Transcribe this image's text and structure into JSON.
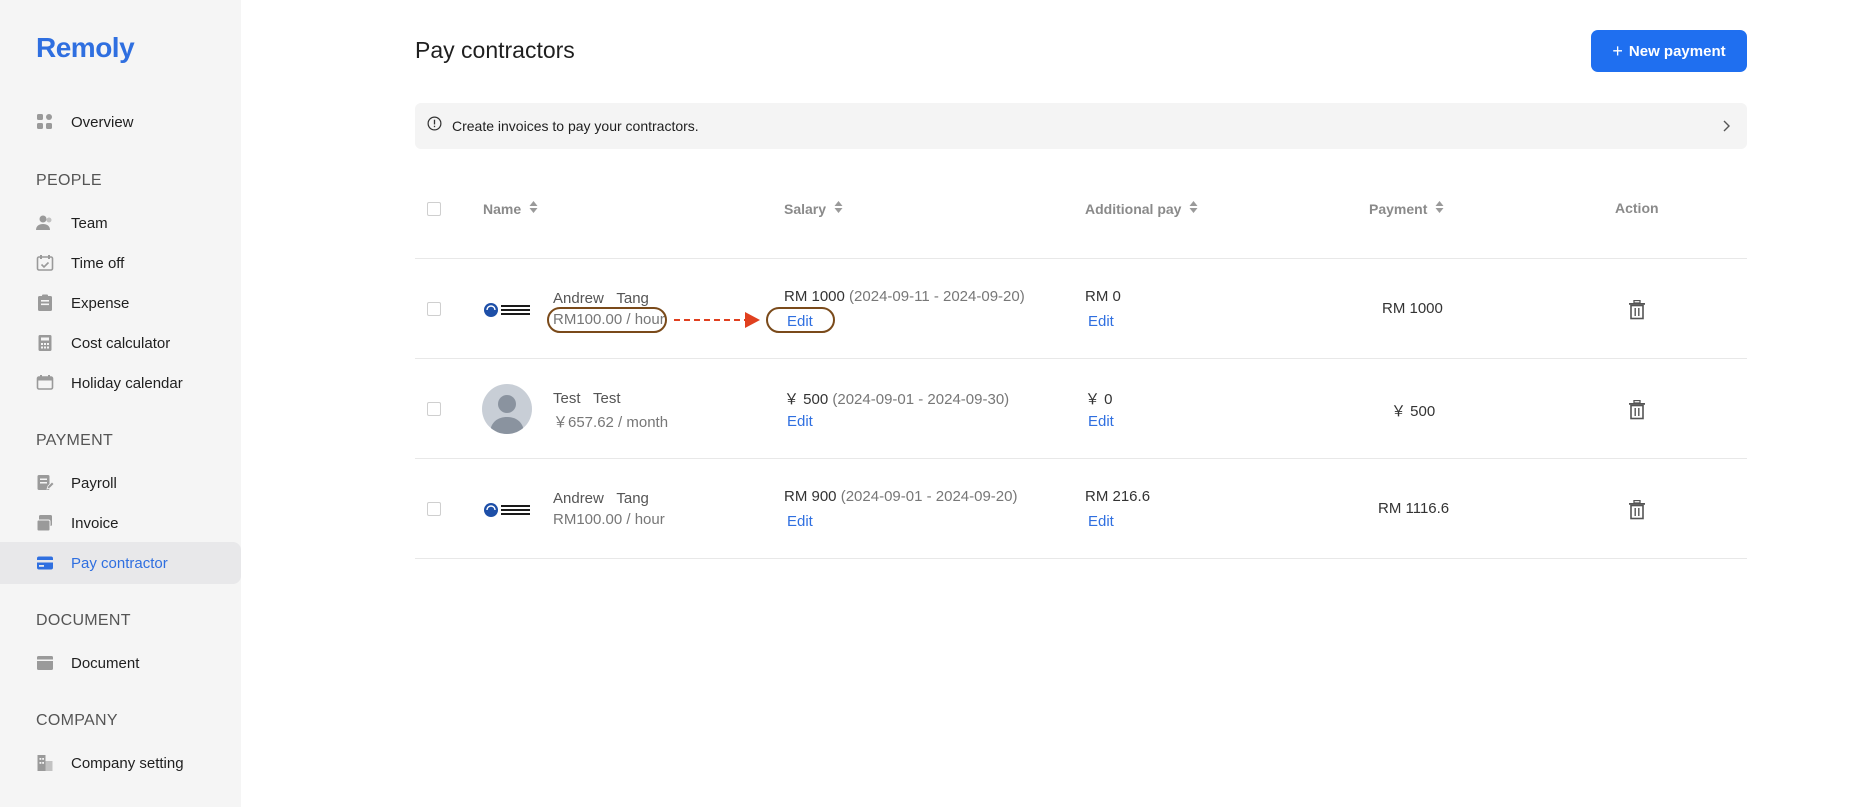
{
  "brand": "Remoly",
  "sidebar": {
    "overview": "Overview",
    "sections": {
      "people": "PEOPLE",
      "payment": "PAYMENT",
      "document": "DOCUMENT",
      "company": "COMPANY"
    },
    "items": {
      "team": "Team",
      "time_off": "Time off",
      "expense": "Expense",
      "cost_calculator": "Cost calculator",
      "holiday_calendar": "Holiday calendar",
      "payroll": "Payroll",
      "invoice": "Invoice",
      "pay_contractor": "Pay contractor",
      "document": "Document",
      "company_setting": "Company setting"
    }
  },
  "header": {
    "title": "Pay contractors",
    "new_payment": "New payment"
  },
  "info": {
    "text": "Create invoices to pay your contractors."
  },
  "table": {
    "columns": {
      "name": "Name",
      "salary": "Salary",
      "additional": "Additional pay",
      "payment": "Payment",
      "action": "Action"
    },
    "rows": [
      {
        "first": "Andrew",
        "last": "Tang",
        "rate": "RM100.00 / hour",
        "salary_amount": "RM 1000",
        "salary_period": "(2024-09-11 - 2024-09-20)",
        "salary_edit": "Edit",
        "additional": "RM 0",
        "additional_edit": "Edit",
        "payment": "RM 1000"
      },
      {
        "first": "Test",
        "last": "Test",
        "rate": "￥657.62 / month",
        "salary_amount": "￥ 500",
        "salary_period": "(2024-09-01 - 2024-09-30)",
        "salary_edit": "Edit",
        "additional": "￥ 0",
        "additional_edit": "Edit",
        "payment": "￥ 500"
      },
      {
        "first": "Andrew",
        "last": "Tang",
        "rate": "RM100.00 / hour",
        "salary_amount": "RM 900",
        "salary_period": "(2024-09-01 - 2024-09-20)",
        "salary_edit": "Edit",
        "additional": "RM 216.6",
        "additional_edit": "Edit",
        "payment": "RM 1116.6"
      }
    ]
  },
  "colors": {
    "accent": "#1f6ff0",
    "annotation_oval": "#7a4a1a",
    "annotation_arrow": "#e0401f"
  }
}
